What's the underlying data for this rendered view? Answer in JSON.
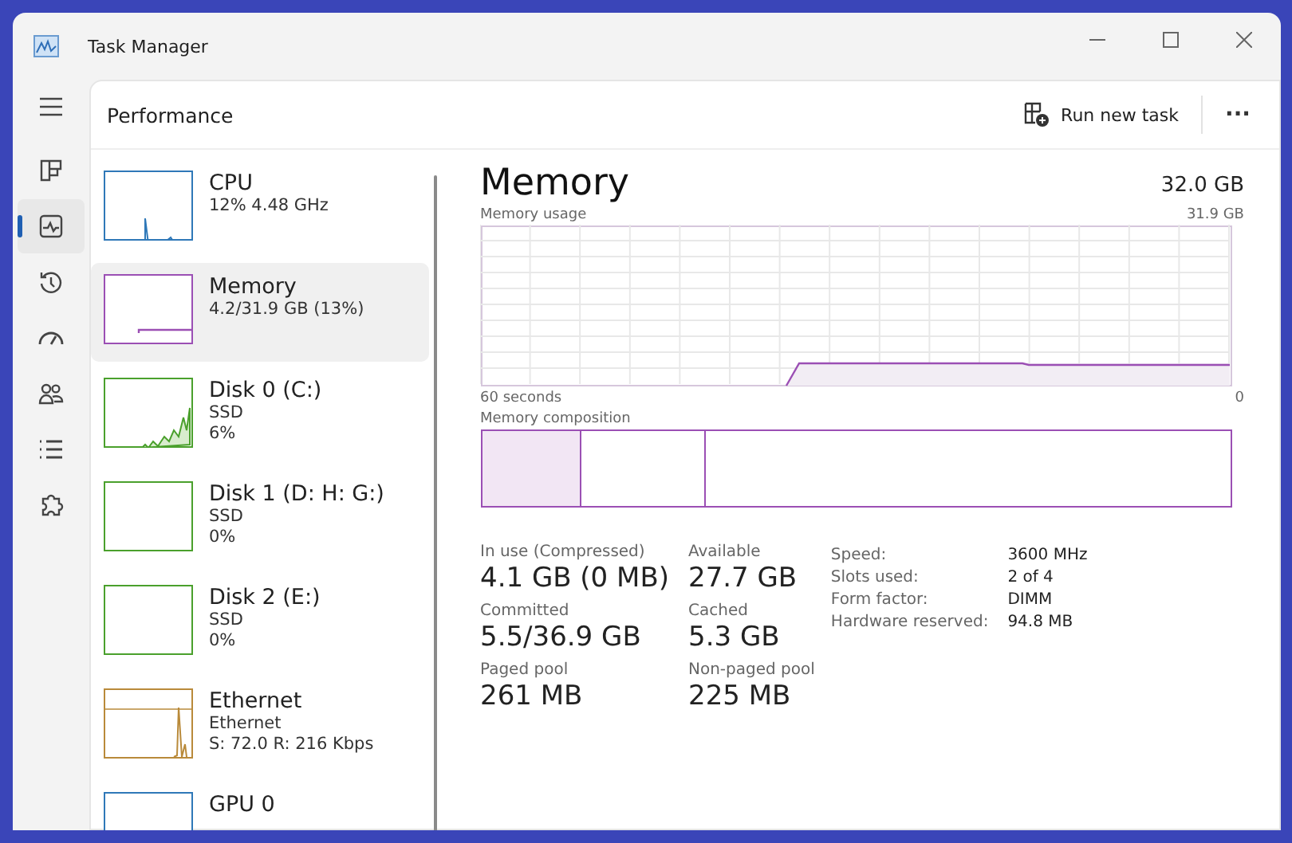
{
  "window": {
    "title": "Task Manager"
  },
  "nav": [
    {
      "kind": "menu",
      "selected": false
    },
    {
      "kind": "processes",
      "selected": false
    },
    {
      "kind": "performance",
      "selected": true
    },
    {
      "kind": "history",
      "selected": false
    },
    {
      "kind": "startup",
      "selected": false
    },
    {
      "kind": "users",
      "selected": false
    },
    {
      "kind": "details",
      "selected": false
    },
    {
      "kind": "services",
      "selected": false
    }
  ],
  "header": {
    "title": "Performance",
    "run_task": "Run new task",
    "more": "···"
  },
  "devices": [
    {
      "name": "CPU",
      "lines": [
        "12%  4.48 GHz"
      ],
      "selected": false,
      "kind": "cpu",
      "color": "#2f78b8"
    },
    {
      "name": "Memory",
      "lines": [
        "4.2/31.9 GB (13%)"
      ],
      "selected": true,
      "kind": "memory",
      "color": "#9b4fb4"
    },
    {
      "name": "Disk 0 (C:)",
      "lines": [
        "SSD",
        "6%"
      ],
      "selected": false,
      "kind": "disk",
      "color": "#4aa02c"
    },
    {
      "name": "Disk 1 (D: H: G:)",
      "lines": [
        "SSD",
        "0%"
      ],
      "selected": false,
      "kind": "idle",
      "color": "#4aa02c"
    },
    {
      "name": "Disk 2 (E:)",
      "lines": [
        "SSD",
        "0%"
      ],
      "selected": false,
      "kind": "idle",
      "color": "#4aa02c"
    },
    {
      "name": "Ethernet",
      "lines": [
        "Ethernet",
        "S: 72.0  R: 216 Kbps"
      ],
      "selected": false,
      "kind": "ethernet",
      "color": "#b98a3a"
    },
    {
      "name": "GPU 0",
      "selected": false,
      "kind": "idle",
      "color": "#2f78b8"
    }
  ],
  "detail": {
    "title": "Memory",
    "total": "32.0 GB",
    "usage_label": "Memory usage",
    "usage_max": "31.9 GB",
    "time_label": "60 seconds",
    "time_min": "0",
    "composition_label": "Memory composition",
    "stats": [
      {
        "label": "In use (Compressed)",
        "value": "4.1 GB (0 MB)"
      },
      {
        "label": "Available",
        "value": "27.7 GB"
      },
      {
        "label": "Committed",
        "value": "5.5/36.9 GB"
      },
      {
        "label": "Cached",
        "value": "5.3 GB"
      },
      {
        "label": "Paged pool",
        "value": "261 MB"
      },
      {
        "label": "Non-paged pool",
        "value": "225 MB"
      }
    ],
    "properties": [
      {
        "label": "Speed:",
        "value": "3600 MHz"
      },
      {
        "label": "Slots used:",
        "value": "2 of 4"
      },
      {
        "label": "Form factor:",
        "value": "DIMM"
      },
      {
        "label": "Hardware reserved:",
        "value": "94.8 MB"
      }
    ]
  }
}
